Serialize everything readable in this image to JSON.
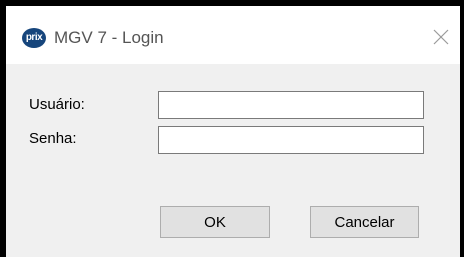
{
  "window": {
    "title": "MGV 7 - Login",
    "app_icon": {
      "name": "prix-logo-icon",
      "text": "prix",
      "color": "#16457c"
    },
    "close_icon": "close-icon"
  },
  "form": {
    "username_label": "Usuário:",
    "username_value": "",
    "password_label": "Senha:",
    "password_value": ""
  },
  "buttons": {
    "ok_label": "OK",
    "cancel_label": "Cancelar"
  },
  "colors": {
    "titlebar": "#ffffff",
    "body": "#f0f0f0",
    "button": "#e1e1e1",
    "frame": "#000000"
  }
}
